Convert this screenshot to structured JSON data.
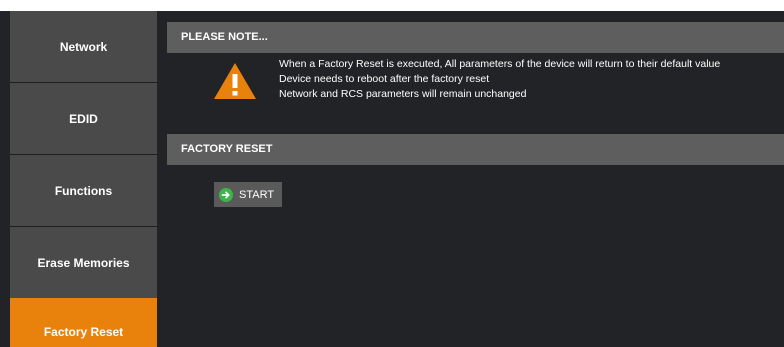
{
  "sidebar": {
    "items": [
      {
        "label": "Network"
      },
      {
        "label": "EDID"
      },
      {
        "label": "Functions"
      },
      {
        "label": "Erase Memories"
      },
      {
        "label": "Factory Reset",
        "active": true
      }
    ]
  },
  "note": {
    "header": "PLEASE NOTE...",
    "lines": [
      "When a Factory Reset is executed, All parameters of the device will return to their default value",
      "Device needs to reboot after the factory reset",
      "Network and RCS parameters will remain unchanged"
    ],
    "icon": "warning-icon"
  },
  "factory_reset": {
    "header": "FACTORY RESET",
    "start_label": "START",
    "start_icon": "arrow-right-circle-icon"
  },
  "colors": {
    "accent": "#e8820c",
    "background": "#222326",
    "header": "#5e5e5e",
    "nav_item": "#4a4a4a",
    "button_icon": "#3db54a"
  }
}
